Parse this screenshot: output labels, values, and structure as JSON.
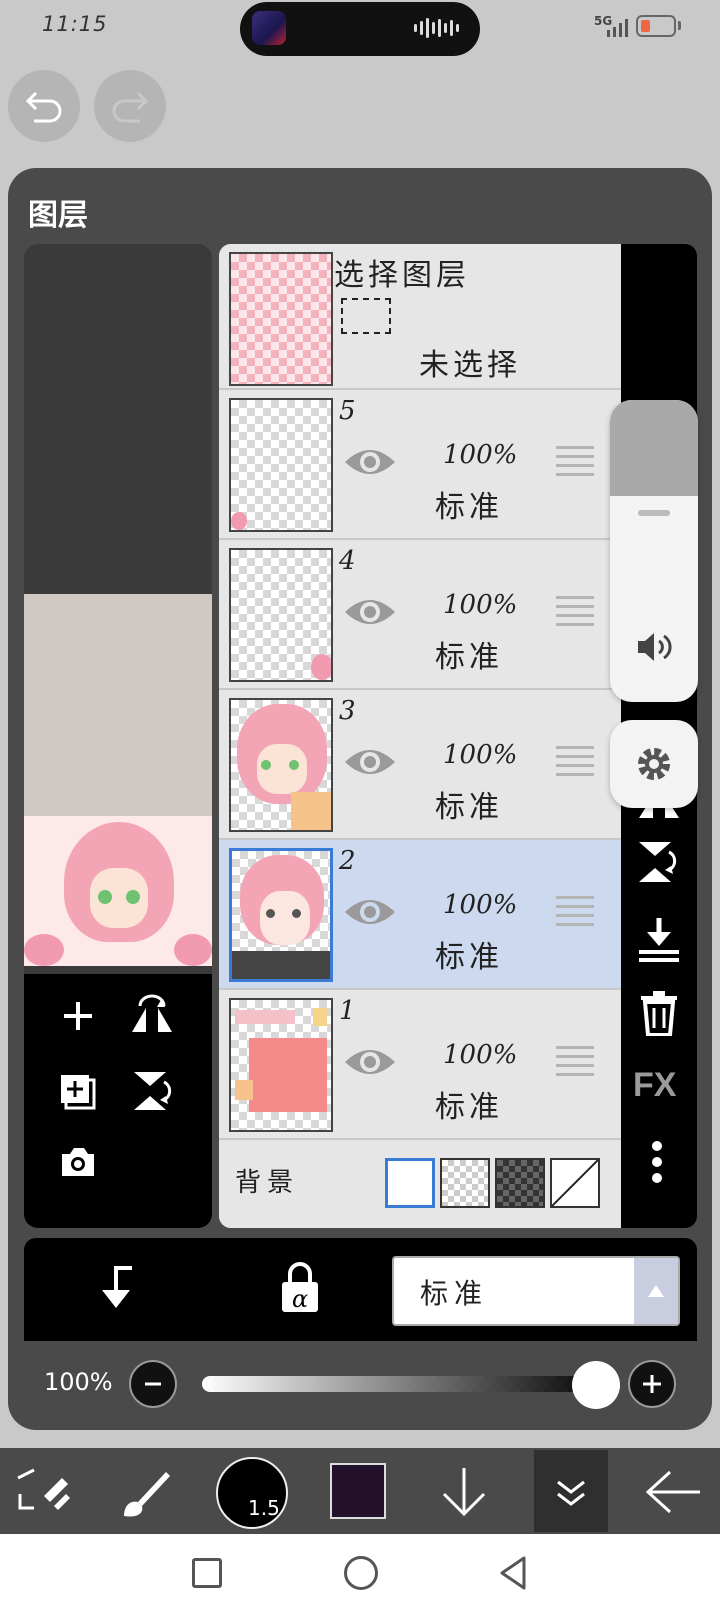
{
  "status": {
    "time": "11:15",
    "network": "5G"
  },
  "panel": {
    "title": "图层"
  },
  "select_layer": {
    "title": "选择图层",
    "status": "未选择"
  },
  "layers": [
    {
      "number": "5",
      "opacity": "100%",
      "blend": "标准",
      "visible": true,
      "selected": false
    },
    {
      "number": "4",
      "opacity": "100%",
      "blend": "标准",
      "visible": true,
      "selected": false
    },
    {
      "number": "3",
      "opacity": "100%",
      "blend": "标准",
      "visible": true,
      "selected": false
    },
    {
      "number": "2",
      "opacity": "100%",
      "blend": "标准",
      "visible": true,
      "selected": true
    },
    {
      "number": "1",
      "opacity": "100%",
      "blend": "标准",
      "visible": true,
      "selected": false
    }
  ],
  "background": {
    "label": "背景",
    "options": [
      "white",
      "light-checker",
      "dark-checker",
      "none"
    ],
    "selected": "white"
  },
  "right_tools": {
    "fx_label": "FX"
  },
  "blend_mode": {
    "value": "标准"
  },
  "opacity": {
    "label": "100%",
    "value": 100
  },
  "brush": {
    "size": "1.5"
  },
  "colors": {
    "accent": "#3a7bd5",
    "selected_row": "#cdd9ee",
    "current_color": "#23102a"
  }
}
